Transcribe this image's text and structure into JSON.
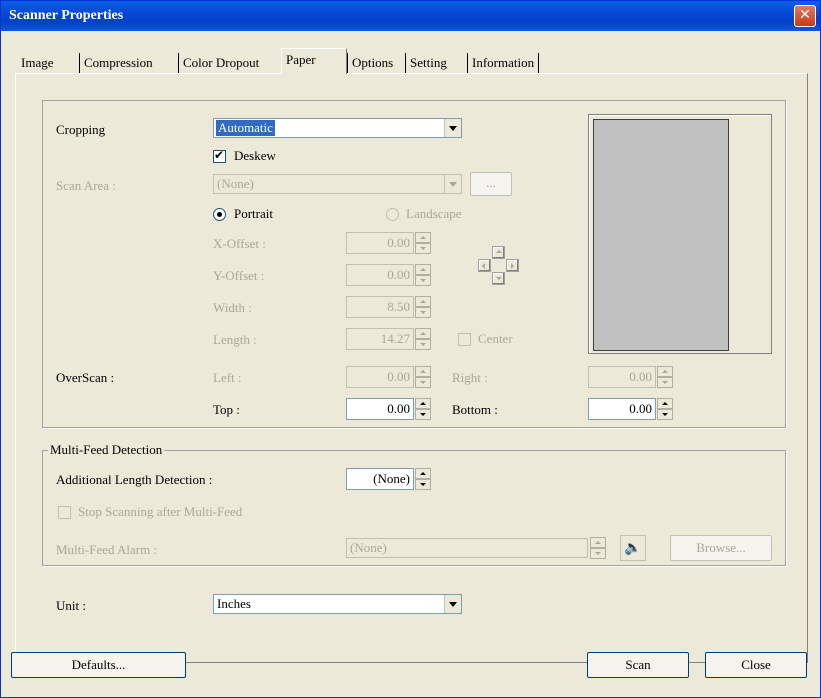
{
  "window": {
    "title": "Scanner Properties",
    "close_glyph": "✕"
  },
  "tabs": [
    {
      "label": "Image"
    },
    {
      "label": "Compression"
    },
    {
      "label": "Color Dropout"
    },
    {
      "label": "Paper"
    },
    {
      "label": "Options"
    },
    {
      "label": "Setting"
    },
    {
      "label": "Information"
    }
  ],
  "active_tab": "Paper",
  "paper": {
    "cropping": {
      "label": "Cropping",
      "value": "Automatic"
    },
    "deskew": {
      "label": "Deskew",
      "checked": true,
      "mark": "✔"
    },
    "scan_area": {
      "label": "Scan Area :",
      "value": "(None)",
      "browse_label": "..."
    },
    "orientation": {
      "portrait_label": "Portrait",
      "landscape_label": "Landscape",
      "selected": "Portrait"
    },
    "x_offset": {
      "label": "X-Offset :",
      "value": "0.00"
    },
    "y_offset": {
      "label": "Y-Offset :",
      "value": "0.00"
    },
    "width": {
      "label": "Width :",
      "value": "8.50"
    },
    "length": {
      "label": "Length :",
      "value": "14.27"
    },
    "center": {
      "label": "Center",
      "checked": false
    },
    "overscan": {
      "label": "OverScan :",
      "left": {
        "label": "Left :",
        "value": "0.00"
      },
      "right": {
        "label": "Right :",
        "value": "0.00"
      },
      "top": {
        "label": "Top :",
        "value": "0.00"
      },
      "bottom": {
        "label": "Bottom :",
        "value": "0.00"
      }
    }
  },
  "multifeed": {
    "legend": "Multi-Feed Detection",
    "additional_length": {
      "label": "Additional Length Detection :",
      "value": "(None)"
    },
    "stop_scanning": {
      "label": "Stop Scanning after Multi-Feed",
      "checked": false
    },
    "alarm": {
      "label": "Multi-Feed Alarm :",
      "value": "(None)",
      "browse_label": "Browse..."
    },
    "speaker_glyph": "🔈"
  },
  "unit": {
    "label": "Unit :",
    "value": "Inches"
  },
  "buttons": {
    "defaults": "Defaults...",
    "scan": "Scan",
    "close": "Close"
  }
}
